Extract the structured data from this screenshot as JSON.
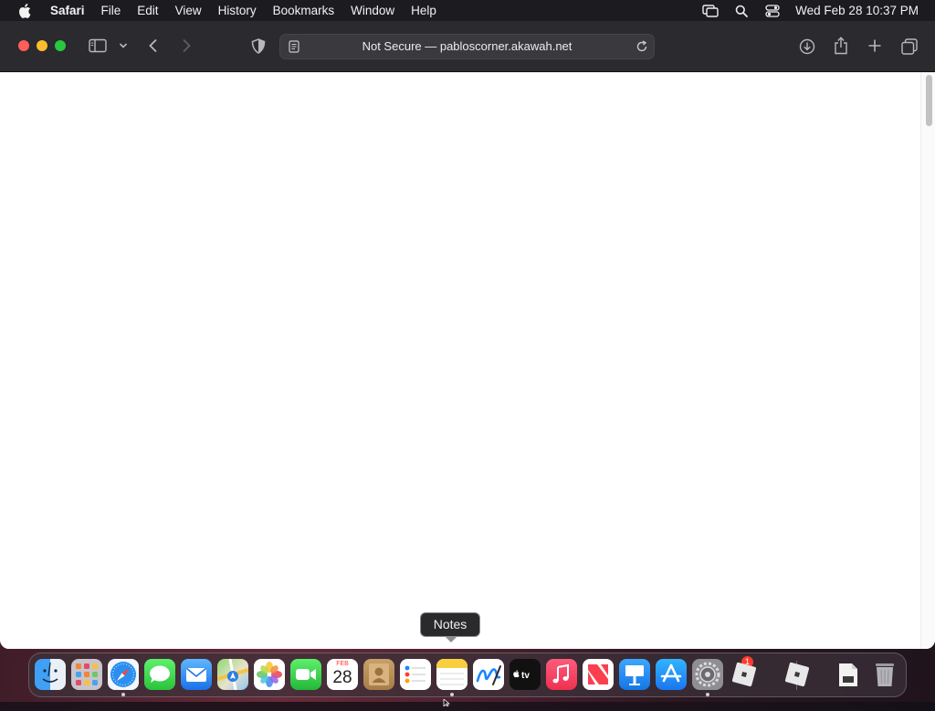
{
  "menubar": {
    "app_name": "Safari",
    "items": [
      "File",
      "Edit",
      "View",
      "History",
      "Bookmarks",
      "Window",
      "Help"
    ],
    "clock": "Wed Feb 28  10:37 PM"
  },
  "browser": {
    "address": "Not Secure — pabloscorner.akawah.net"
  },
  "tooltip": {
    "label": "Notes"
  },
  "dock": {
    "apps": [
      "Finder",
      "Launchpad",
      "Safari",
      "Messages",
      "Mail",
      "Maps",
      "Photos",
      "FaceTime",
      "Calendar",
      "Contacts",
      "Reminders",
      "Notes",
      "Freeform",
      "TV",
      "Music",
      "News",
      "Keynote",
      "App Store",
      "System Settings",
      "Roblox",
      "Roblox Studio",
      "Documents",
      "Trash"
    ],
    "calendar_month": "FEB",
    "calendar_day": "28",
    "settings_badge": "1"
  }
}
